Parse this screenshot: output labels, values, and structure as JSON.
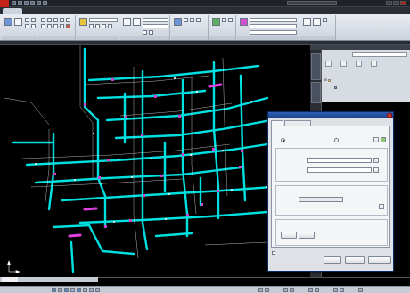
{
  "app": {
    "window_title": "",
    "search_placeholder": "",
    "colors": {
      "accent": "#c42117",
      "titlebar": "#1f2228",
      "drawing_bg": "#000000"
    }
  },
  "quick_access": [
    {
      "icon": "new-icon"
    },
    {
      "icon": "open-icon"
    },
    {
      "icon": "save-icon"
    },
    {
      "icon": "undo-icon"
    },
    {
      "icon": "redo-icon"
    },
    {
      "icon": "plot-icon"
    }
  ],
  "ribbon_tabs": [
    {
      "label": ""
    },
    {
      "label": ""
    },
    {
      "label": ""
    },
    {
      "label": ""
    },
    {
      "label": ""
    },
    {
      "label": ""
    },
    {
      "label": ""
    },
    {
      "label": ""
    },
    {
      "label": ""
    },
    {
      "label": ""
    },
    {
      "label": ""
    },
    {
      "label": ""
    }
  ],
  "ribbon_panels": [
    {
      "label": ""
    },
    {
      "label": ""
    },
    {
      "label": ""
    },
    {
      "label": ""
    },
    {
      "label": ""
    },
    {
      "label": ""
    },
    {
      "label": ""
    },
    {
      "label": ""
    }
  ],
  "ribbon": {
    "layer_combo": "",
    "color_combo": "",
    "linetype_combo": "",
    "style_combo": "",
    "dim_combo": ""
  },
  "layout_tabs": [
    {
      "label": ""
    },
    {
      "label": ""
    },
    {
      "label": ""
    }
  ],
  "status": {
    "coords": ""
  },
  "layer_panel": {
    "title": "",
    "current_layer_label": "",
    "current_layer_value": "",
    "tools": [
      {
        "label": "",
        "icon": "new-icon"
      },
      {
        "label": "",
        "icon": "edit-icon"
      },
      {
        "label": "",
        "icon": "delete-icon"
      },
      {
        "label": "",
        "icon": "set-current-icon"
      }
    ],
    "tree": [
      {
        "label": ""
      },
      {
        "label": ""
      }
    ]
  },
  "dialog": {
    "title": "",
    "tabs": [
      {
        "label": ""
      },
      {
        "label": ""
      }
    ],
    "selection_group": "",
    "radio_all": "",
    "radio_select": "",
    "file_group": "",
    "file_name_label": "",
    "file_type_label": "",
    "topology_group": "",
    "topology_label": "",
    "topology_value": "",
    "options_label": "",
    "load_button": "",
    "save_button": "",
    "current_label": "",
    "auto_export_label": "",
    "ok_button": "",
    "cancel_button": "",
    "help_button": "",
    "more_link": ""
  }
}
